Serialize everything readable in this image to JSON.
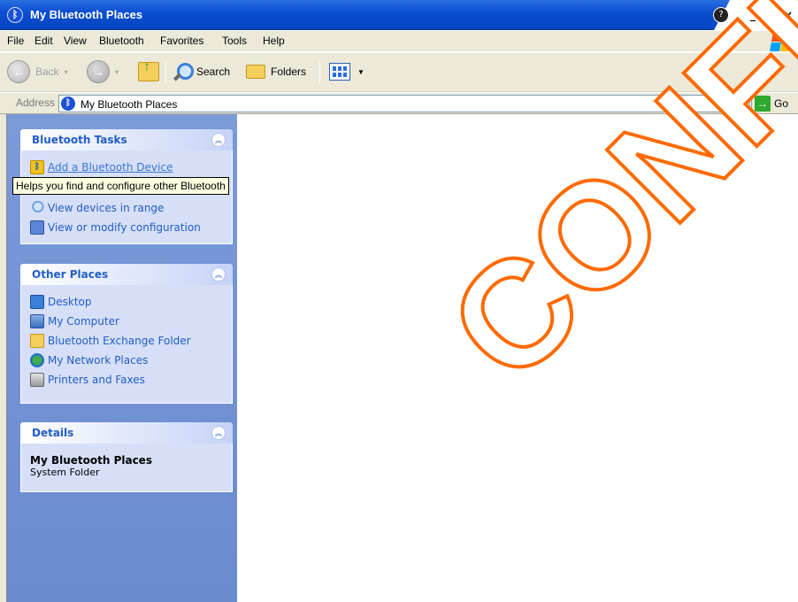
{
  "window": {
    "title": "My Bluetooth Places",
    "help_glyph": "?",
    "min_glyph": "_",
    "max_glyph": "□",
    "close_glyph": "×"
  },
  "menu": {
    "items": [
      "File",
      "Edit",
      "View",
      "Bluetooth",
      "Favorites",
      "Tools",
      "Help"
    ]
  },
  "toolbar": {
    "back_label": "Back",
    "search_label": "Search",
    "folders_label": "Folders"
  },
  "address": {
    "label": "Address",
    "value": "My Bluetooth Places",
    "go_label": "Go"
  },
  "bluetooth_tasks": {
    "title": "Bluetooth Tasks",
    "items": [
      {
        "label": "Add a Bluetooth Device",
        "icon": "bluetooth-device-icon"
      },
      {
        "label": "View devices in range",
        "icon": "magnifier-icon"
      },
      {
        "label": "View or modify configuration",
        "icon": "configuration-icon"
      }
    ]
  },
  "tooltip": {
    "text": "Helps you find and configure other Bluetooth"
  },
  "other_places": {
    "title": "Other Places",
    "items": [
      {
        "label": "Desktop",
        "icon": "desktop-icon"
      },
      {
        "label": "My Computer",
        "icon": "my-computer-icon"
      },
      {
        "label": "Bluetooth Exchange Folder",
        "icon": "folder-icon"
      },
      {
        "label": "My Network Places",
        "icon": "network-places-icon"
      },
      {
        "label": "Printers and Faxes",
        "icon": "printer-icon"
      }
    ]
  },
  "details": {
    "title": "Details",
    "name": "My Bluetooth Places",
    "type": "System Folder"
  },
  "watermark": {
    "text": "CONFID"
  },
  "colors": {
    "title_bar": "#0a4fd0",
    "task_pane": "#6a8bcf",
    "panel_body": "#d6dff7",
    "link": "#215dc6",
    "watermark_stroke": "#ff6a00"
  }
}
